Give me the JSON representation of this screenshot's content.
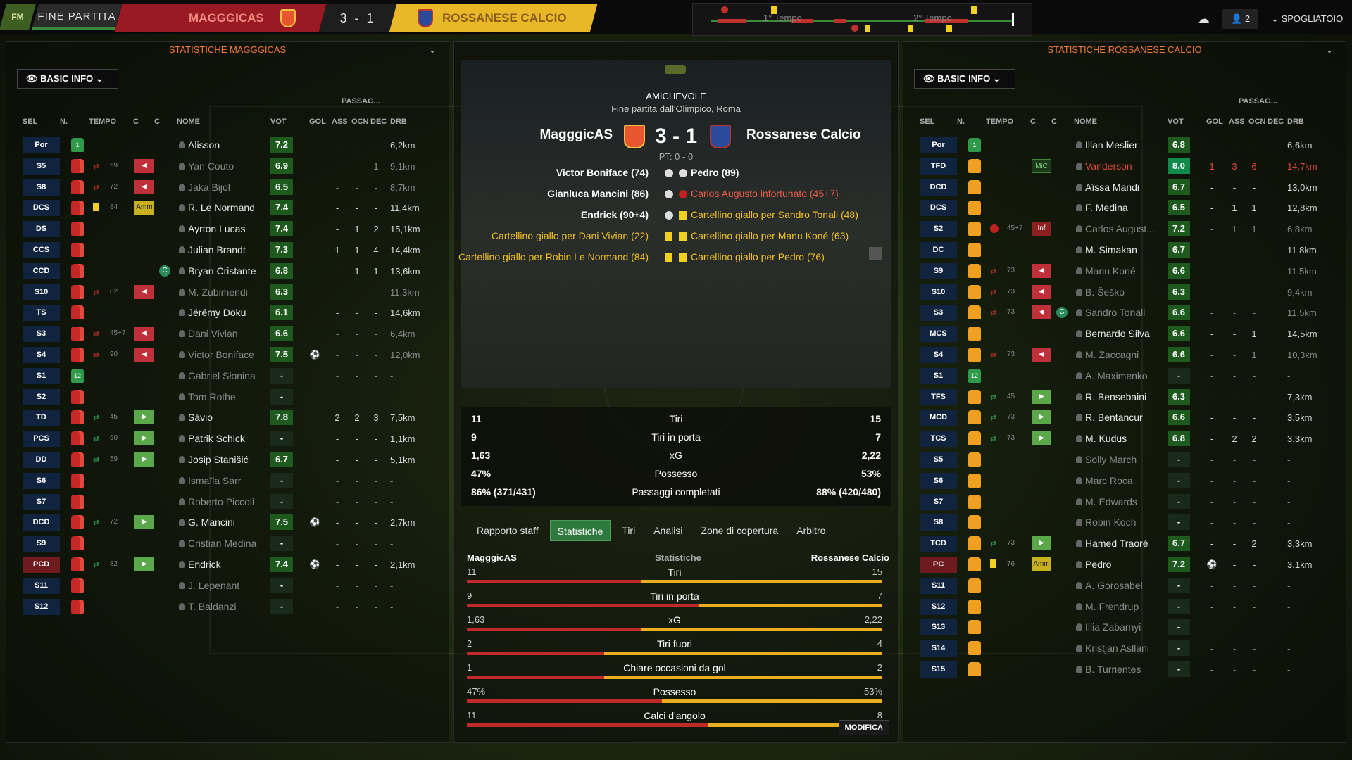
{
  "topbar": {
    "logo": "FM",
    "fine_partita": "FINE PARTITA",
    "home_team": "MAGGGICAS",
    "score": "3 - 1",
    "away_team": "ROSSANESE CALCIO",
    "first_half": "1° Tempo",
    "second_half": "2° Tempo",
    "users_count": "2",
    "spogliatoio": "SPOGLIATOIO"
  },
  "left": {
    "title": "STATISTICHE MAGGGICAS",
    "basic_info": "BASIC INFO",
    "passag": "PASSAG...",
    "headers": [
      "SEL",
      "N.",
      "TEMPO",
      "C",
      "C",
      "NOME",
      "VOT",
      "GOL",
      "ASS",
      "OCN",
      "DEC",
      "DRB"
    ],
    "players": [
      {
        "pos": "Por",
        "num": "1",
        "gk": true,
        "sub": "",
        "mins": "",
        "c": "",
        "cap": false,
        "name": "Alisson",
        "dim": false,
        "vot": "7.2",
        "gol": "",
        "ass": "-",
        "ocn": "-",
        "dec": "-",
        "drb": "6,2km"
      },
      {
        "pos": "S5",
        "num": "",
        "sub": "out",
        "mins": "59",
        "c": "out",
        "cap": false,
        "name": "Yan Couto",
        "dim": true,
        "vot": "6.9",
        "gol": "",
        "ass": "-",
        "ocn": "-",
        "dec": "1",
        "drb": "9,1km"
      },
      {
        "pos": "S8",
        "num": "",
        "sub": "out",
        "mins": "72",
        "c": "out",
        "cap": false,
        "name": "Jaka Bijol",
        "dim": true,
        "vot": "6.5",
        "gol": "",
        "ass": "-",
        "ocn": "-",
        "dec": "-",
        "drb": "8,7km"
      },
      {
        "pos": "DCS",
        "num": "",
        "sub": "yellow",
        "mins": "84",
        "c": "amm",
        "cap": false,
        "name": "R. Le Normand",
        "dim": false,
        "vot": "7.4",
        "gol": "",
        "ass": "-",
        "ocn": "-",
        "dec": "-",
        "drb": "11,4km"
      },
      {
        "pos": "DS",
        "num": "",
        "sub": "",
        "mins": "",
        "c": "",
        "cap": false,
        "name": "Ayrton Lucas",
        "dim": false,
        "vot": "7.4",
        "gol": "",
        "ass": "-",
        "ocn": "1",
        "dec": "2",
        "drb": "15,1km"
      },
      {
        "pos": "CCS",
        "num": "",
        "sub": "",
        "mins": "",
        "c": "",
        "cap": false,
        "name": "Julian Brandt",
        "dim": false,
        "vot": "7.3",
        "gol": "",
        "ass": "1",
        "ocn": "1",
        "dec": "4",
        "drb": "14,4km"
      },
      {
        "pos": "CCD",
        "num": "",
        "sub": "",
        "mins": "",
        "c": "",
        "cap": true,
        "name": "Bryan Cristante",
        "dim": false,
        "vot": "6.8",
        "gol": "",
        "ass": "-",
        "ocn": "1",
        "dec": "1",
        "drb": "13,6km"
      },
      {
        "pos": "S10",
        "num": "",
        "sub": "out",
        "mins": "82",
        "c": "out",
        "cap": false,
        "name": "M. Zubimendi",
        "dim": true,
        "vot": "6.3",
        "gol": "",
        "ass": "-",
        "ocn": "-",
        "dec": "-",
        "drb": "11,3km"
      },
      {
        "pos": "TS",
        "num": "",
        "sub": "",
        "mins": "",
        "c": "",
        "cap": false,
        "name": "Jérémy Doku",
        "dim": false,
        "vot": "6.1",
        "gol": "",
        "ass": "-",
        "ocn": "-",
        "dec": "-",
        "drb": "14,6km"
      },
      {
        "pos": "S3",
        "num": "",
        "sub": "out",
        "mins": "45+7",
        "c": "out",
        "cap": false,
        "name": "Dani Vivian",
        "dim": true,
        "vot": "6.6",
        "gol": "",
        "ass": "-",
        "ocn": "-",
        "dec": "-",
        "drb": "6,4km"
      },
      {
        "pos": "S4",
        "num": "",
        "sub": "out",
        "mins": "90",
        "c": "out",
        "cap": false,
        "name": "Victor Boniface",
        "dim": true,
        "vot": "7.5",
        "gol": "ball",
        "ass": "-",
        "ocn": "-",
        "dec": "-",
        "drb": "12,0km"
      },
      {
        "pos": "S1",
        "num": "12",
        "gk": true,
        "sub": "",
        "mins": "",
        "c": "",
        "cap": false,
        "name": "Gabriel Słonina",
        "dim": true,
        "vot": "-",
        "gol": "",
        "ass": "-",
        "ocn": "-",
        "dec": "-",
        "drb": "-"
      },
      {
        "pos": "S2",
        "num": "",
        "sub": "",
        "mins": "",
        "c": "",
        "cap": false,
        "name": "Tom Rothe",
        "dim": true,
        "vot": "-",
        "gol": "",
        "ass": "-",
        "ocn": "-",
        "dec": "-",
        "drb": "-"
      },
      {
        "pos": "TD",
        "num": "",
        "sub": "in",
        "mins": "45",
        "c": "in",
        "cap": false,
        "name": "Sávio",
        "dim": false,
        "vot": "7.8",
        "gol": "",
        "ass": "2",
        "ocn": "2",
        "dec": "3",
        "drb": "7,5km"
      },
      {
        "pos": "PCS",
        "num": "",
        "sub": "in",
        "mins": "90",
        "c": "in",
        "cap": false,
        "name": "Patrik Schick",
        "dim": false,
        "vot": "-",
        "gol": "",
        "ass": "-",
        "ocn": "-",
        "dec": "-",
        "drb": "1,1km"
      },
      {
        "pos": "DD",
        "num": "",
        "sub": "in",
        "mins": "59",
        "c": "in",
        "cap": false,
        "name": "Josip Stanišić",
        "dim": false,
        "vot": "6.7",
        "gol": "",
        "ass": "-",
        "ocn": "-",
        "dec": "-",
        "drb": "5,1km"
      },
      {
        "pos": "S6",
        "num": "",
        "sub": "",
        "mins": "",
        "c": "",
        "cap": false,
        "name": "Ismaïla Sarr",
        "dim": true,
        "vot": "-",
        "gol": "",
        "ass": "-",
        "ocn": "-",
        "dec": "-",
        "drb": "-"
      },
      {
        "pos": "S7",
        "num": "",
        "sub": "",
        "mins": "",
        "c": "",
        "cap": false,
        "name": "Roberto Piccoli",
        "dim": true,
        "vot": "-",
        "gol": "",
        "ass": "-",
        "ocn": "-",
        "dec": "-",
        "drb": "-"
      },
      {
        "pos": "DCD",
        "num": "",
        "sub": "in",
        "mins": "72",
        "c": "in",
        "cap": false,
        "name": "G. Mancini",
        "dim": false,
        "vot": "7.5",
        "gol": "ball",
        "ass": "-",
        "ocn": "-",
        "dec": "-",
        "drb": "2,7km"
      },
      {
        "pos": "S9",
        "num": "",
        "sub": "",
        "mins": "",
        "c": "",
        "cap": false,
        "name": "Cristian Medina",
        "dim": true,
        "vot": "-",
        "gol": "",
        "ass": "-",
        "ocn": "-",
        "dec": "-",
        "drb": "-"
      },
      {
        "pos": "PCD",
        "num": "",
        "sub": "in",
        "mins": "82",
        "c": "in",
        "cap": false,
        "name": "Endrick",
        "dim": false,
        "vot": "7.4",
        "gol": "ball",
        "ass": "-",
        "ocn": "-",
        "dec": "-",
        "drb": "2,1km",
        "redpos": true
      },
      {
        "pos": "S11",
        "num": "",
        "sub": "",
        "mins": "",
        "c": "",
        "cap": false,
        "name": "J. Lepenant",
        "dim": true,
        "vot": "-",
        "gol": "",
        "ass": "-",
        "ocn": "-",
        "dec": "-",
        "drb": "-"
      },
      {
        "pos": "S12",
        "num": "",
        "sub": "",
        "mins": "",
        "c": "",
        "cap": false,
        "name": "T. Baldanzi",
        "dim": true,
        "vot": "-",
        "gol": "",
        "ass": "-",
        "ocn": "-",
        "dec": "-",
        "drb": "-"
      }
    ]
  },
  "right": {
    "title": "STATISTICHE ROSSANESE CALCIO",
    "basic_info": "BASIC INFO",
    "passag": "PASSAG...",
    "headers": [
      "SEL",
      "N.",
      "TEMPO",
      "C",
      "C",
      "NOME",
      "VOT",
      "GOL",
      "ASS",
      "OCN",
      "DEC",
      "DRB"
    ],
    "players": [
      {
        "pos": "Por",
        "num": "1",
        "gk": true,
        "sub": "",
        "mins": "",
        "c": "",
        "cap": false,
        "name": "Illan Meslier",
        "dim": false,
        "vot": "6.8",
        "gol": "-",
        "ass": "-",
        "ocn": "-",
        "dec": "-",
        "drb": "6,6km"
      },
      {
        "pos": "TFD",
        "num": "",
        "sub": "",
        "mins": "",
        "c": "mic",
        "cap": false,
        "name": "Vanderson",
        "dim": false,
        "red": true,
        "vot": "8.0",
        "top": true,
        "gol": "1",
        "ass": "3",
        "ocn": "6",
        "dec": "",
        "drb": "14,7km",
        "redstats": true
      },
      {
        "pos": "DCD",
        "num": "",
        "sub": "",
        "mins": "",
        "c": "",
        "cap": false,
        "name": "Aïssa Mandi",
        "dim": false,
        "vot": "6.7",
        "gol": "-",
        "ass": "-",
        "ocn": "-",
        "dec": "",
        "drb": "13,0km"
      },
      {
        "pos": "DCS",
        "num": "",
        "sub": "",
        "mins": "",
        "c": "",
        "cap": false,
        "name": "F. Medina",
        "dim": false,
        "vot": "6.5",
        "gol": "-",
        "ass": "1",
        "ocn": "1",
        "dec": "",
        "drb": "12,8km"
      },
      {
        "pos": "S2",
        "num": "",
        "sub": "inj",
        "mins": "45+7",
        "c": "inf",
        "cap": false,
        "name": "Carlos August...",
        "dim": true,
        "vot": "7.2",
        "gol": "-",
        "ass": "1",
        "ocn": "1",
        "dec": "",
        "drb": "6,8km"
      },
      {
        "pos": "DC",
        "num": "",
        "sub": "",
        "mins": "",
        "c": "",
        "cap": false,
        "name": "M. Simakan",
        "dim": false,
        "vot": "6.7",
        "gol": "-",
        "ass": "-",
        "ocn": "-",
        "dec": "",
        "drb": "11,8km"
      },
      {
        "pos": "S9",
        "num": "",
        "sub": "out",
        "mins": "73",
        "c": "out",
        "cap": false,
        "name": "Manu Koné",
        "dim": true,
        "vot": "6.6",
        "gol": "-",
        "ass": "-",
        "ocn": "-",
        "dec": "",
        "drb": "11,5km"
      },
      {
        "pos": "S10",
        "num": "",
        "sub": "out",
        "mins": "73",
        "c": "out",
        "cap": false,
        "name": "B. Šeško",
        "dim": true,
        "vot": "6.3",
        "gol": "-",
        "ass": "-",
        "ocn": "-",
        "dec": "",
        "drb": "9,4km"
      },
      {
        "pos": "S3",
        "num": "",
        "sub": "out",
        "mins": "73",
        "c": "out",
        "cap": true,
        "name": "Sandro Tonali",
        "dim": true,
        "vot": "6.6",
        "gol": "-",
        "ass": "-",
        "ocn": "-",
        "dec": "",
        "drb": "11,5km"
      },
      {
        "pos": "MCS",
        "num": "",
        "sub": "",
        "mins": "",
        "c": "",
        "cap": false,
        "name": "Bernardo Silva",
        "dim": false,
        "vot": "6.6",
        "gol": "-",
        "ass": "-",
        "ocn": "1",
        "dec": "",
        "drb": "14,5km"
      },
      {
        "pos": "S4",
        "num": "",
        "sub": "out",
        "mins": "73",
        "c": "out",
        "cap": false,
        "name": "M. Zaccagni",
        "dim": true,
        "vot": "6.6",
        "gol": "-",
        "ass": "-",
        "ocn": "1",
        "dec": "",
        "drb": "10,3km"
      },
      {
        "pos": "S1",
        "num": "12",
        "gk": true,
        "sub": "",
        "mins": "",
        "c": "",
        "cap": false,
        "name": "A. Maximenko",
        "dim": true,
        "vot": "-",
        "gol": "-",
        "ass": "-",
        "ocn": "-",
        "dec": "",
        "drb": "-"
      },
      {
        "pos": "TFS",
        "num": "",
        "sub": "in",
        "mins": "45",
        "c": "in",
        "cap": false,
        "name": "R. Bensebaini",
        "dim": false,
        "vot": "6.3",
        "gol": "-",
        "ass": "-",
        "ocn": "-",
        "dec": "",
        "drb": "7,3km"
      },
      {
        "pos": "MCD",
        "num": "",
        "sub": "in",
        "mins": "73",
        "c": "in",
        "cap": false,
        "name": "R. Bentancur",
        "dim": false,
        "vot": "6.6",
        "gol": "-",
        "ass": "-",
        "ocn": "-",
        "dec": "",
        "drb": "3,5km"
      },
      {
        "pos": "TCS",
        "num": "",
        "sub": "in",
        "mins": "73",
        "c": "in",
        "cap": false,
        "name": "M. Kudus",
        "dim": false,
        "vot": "6.8",
        "gol": "-",
        "ass": "2",
        "ocn": "2",
        "dec": "",
        "drb": "3,3km"
      },
      {
        "pos": "S5",
        "num": "",
        "sub": "",
        "mins": "",
        "c": "",
        "cap": false,
        "name": "Solly March",
        "dim": true,
        "vot": "-",
        "gol": "-",
        "ass": "-",
        "ocn": "-",
        "dec": "",
        "drb": "-"
      },
      {
        "pos": "S6",
        "num": "",
        "sub": "",
        "mins": "",
        "c": "",
        "cap": false,
        "name": "Marc Roca",
        "dim": true,
        "vot": "-",
        "gol": "-",
        "ass": "-",
        "ocn": "-",
        "dec": "",
        "drb": "-"
      },
      {
        "pos": "S7",
        "num": "",
        "sub": "",
        "mins": "",
        "c": "",
        "cap": false,
        "name": "M. Edwards",
        "dim": true,
        "vot": "-",
        "gol": "-",
        "ass": "-",
        "ocn": "-",
        "dec": "",
        "drb": "-"
      },
      {
        "pos": "S8",
        "num": "",
        "sub": "",
        "mins": "",
        "c": "",
        "cap": false,
        "name": "Robin Koch",
        "dim": true,
        "vot": "-",
        "gol": "-",
        "ass": "-",
        "ocn": "-",
        "dec": "",
        "drb": "-"
      },
      {
        "pos": "TCD",
        "num": "",
        "sub": "in",
        "mins": "73",
        "c": "in",
        "cap": false,
        "name": "Hamed Traoré",
        "dim": false,
        "vot": "6.7",
        "gol": "-",
        "ass": "-",
        "ocn": "2",
        "dec": "",
        "drb": "3,3km"
      },
      {
        "pos": "PC",
        "num": "",
        "sub": "yellow",
        "mins": "76",
        "c": "amm",
        "cap": false,
        "name": "Pedro",
        "dim": false,
        "vot": "7.2",
        "gol": "ball",
        "ass": "-",
        "ocn": "-",
        "dec": "",
        "drb": "3,1km",
        "redpos": true
      },
      {
        "pos": "S11",
        "num": "",
        "sub": "",
        "mins": "",
        "c": "",
        "cap": false,
        "name": "A. Gorosabel",
        "dim": true,
        "vot": "-",
        "gol": "-",
        "ass": "-",
        "ocn": "-",
        "dec": "",
        "drb": "-"
      },
      {
        "pos": "S12",
        "num": "",
        "sub": "",
        "mins": "",
        "c": "",
        "cap": false,
        "name": "M. Frendrup",
        "dim": true,
        "vot": "-",
        "gol": "-",
        "ass": "-",
        "ocn": "-",
        "dec": "",
        "drb": "-"
      },
      {
        "pos": "S13",
        "num": "",
        "sub": "",
        "mins": "",
        "c": "",
        "cap": false,
        "name": "Illia Zabarnyi",
        "dim": true,
        "vot": "-",
        "gol": "-",
        "ass": "-",
        "ocn": "-",
        "dec": "",
        "drb": "-"
      },
      {
        "pos": "S14",
        "num": "",
        "sub": "",
        "mins": "",
        "c": "",
        "cap": false,
        "name": "Kristjan Asllani",
        "dim": true,
        "vot": "-",
        "gol": "-",
        "ass": "-",
        "ocn": "-",
        "dec": "",
        "drb": "-"
      },
      {
        "pos": "S15",
        "num": "",
        "sub": "",
        "mins": "",
        "c": "",
        "cap": false,
        "name": "B. Turrientes",
        "dim": true,
        "vot": "-",
        "gol": "-",
        "ass": "-",
        "ocn": "-",
        "dec": "",
        "drb": "-"
      }
    ]
  },
  "center": {
    "competition": "AMICHEVOLE",
    "subtitle": "Fine partita dall'Olimpico, Roma",
    "home": "MagggicAS",
    "away": "Rossanese Calcio",
    "score": "3 - 1",
    "ht": "PT: 0 - 0",
    "events_left": [
      {
        "text": "Victor Boniface (74)",
        "type": "goal"
      },
      {
        "text": "Gianluca Mancini (86)",
        "type": "goal"
      },
      {
        "text": "Endrick (90+4)",
        "type": "goal"
      },
      {
        "text": "Cartellino giallo per Dani Vivian (22)",
        "type": "yellow"
      },
      {
        "text": "Cartellino giallo per Robin Le Normand (84)",
        "type": "yellow"
      }
    ],
    "events_right": [
      {
        "text": "Pedro (89)",
        "type": "goal"
      },
      {
        "text": "Carlos Augusto infortunato (45+7)",
        "type": "injury"
      },
      {
        "text": "Cartellino giallo per Sandro Tonali (48)",
        "type": "yellow"
      },
      {
        "text": "Cartellino giallo per Manu Koné (63)",
        "type": "yellow"
      },
      {
        "text": "Cartellino giallo per Pedro (76)",
        "type": "yellow"
      }
    ],
    "summary": [
      {
        "l": "11",
        "c": "Tiri",
        "r": "15"
      },
      {
        "l": "9",
        "c": "Tiri in porta",
        "r": "7"
      },
      {
        "l": "1,63",
        "c": "xG",
        "r": "2,22"
      },
      {
        "l": "47%",
        "c": "Possesso",
        "r": "53%"
      },
      {
        "l": "86% (371/431)",
        "c": "Passaggi completati",
        "r": "88% (420/480)"
      }
    ],
    "tabs": [
      "Rapporto staff",
      "Statistiche",
      "Tiri",
      "Analisi",
      "Zone di copertura",
      "Arbitro"
    ],
    "active_tab": 1,
    "stats_header": {
      "l": "MagggicAS",
      "c": "Statistiche",
      "r": "Rossanese Calcio"
    },
    "stats": [
      {
        "l": "11",
        "c": "Tiri",
        "r": "15",
        "lf": 0.42,
        "rf": 0.58
      },
      {
        "l": "9",
        "c": "Tiri in porta",
        "r": "7",
        "lf": 0.56,
        "rf": 0.44
      },
      {
        "l": "1,63",
        "c": "xG",
        "r": "2,22",
        "lf": 0.42,
        "rf": 0.58
      },
      {
        "l": "2",
        "c": "Tiri fuori",
        "r": "4",
        "lf": 0.33,
        "rf": 0.67
      },
      {
        "l": "1",
        "c": "Chiare occasioni da gol",
        "r": "2",
        "lf": 0.33,
        "rf": 0.67
      },
      {
        "l": "47%",
        "c": "Possesso",
        "r": "53%",
        "lf": 0.47,
        "rf": 0.53
      },
      {
        "l": "11",
        "c": "Calci d'angolo",
        "r": "8",
        "lf": 0.58,
        "rf": 0.42
      }
    ],
    "modifica": "MODIFICA"
  },
  "colors": {
    "home": "#c02a2a",
    "away": "#e8b020",
    "accent": "#2e7a3e"
  }
}
